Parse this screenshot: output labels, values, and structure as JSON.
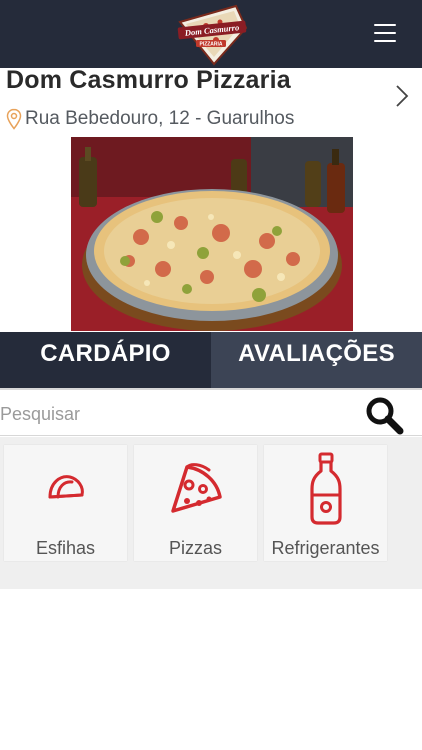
{
  "header": {
    "logo_name": "DOM CASMURRO",
    "logo_sub": "PIZZARIA"
  },
  "shop": {
    "name": "Dom Casmurro Pizzaria",
    "address": "Rua Bebedouro, 12 - Guarulhos"
  },
  "tabs": [
    {
      "label": "CARDÁPIO",
      "active": true
    },
    {
      "label": "AVALIAÇÕES",
      "active": false
    }
  ],
  "search": {
    "placeholder": "Pesquisar"
  },
  "categories": [
    {
      "label": "Esfihas",
      "icon": "taco-icon"
    },
    {
      "label": "Pizzas",
      "icon": "pizza-slice-icon"
    },
    {
      "label": "Refrigerantes",
      "icon": "bottle-icon"
    }
  ],
  "colors": {
    "bar": "#252b3a",
    "tab_inactive": "#3c4455",
    "accent_red": "#d42a2f",
    "pin_orange": "#e8a25a"
  }
}
